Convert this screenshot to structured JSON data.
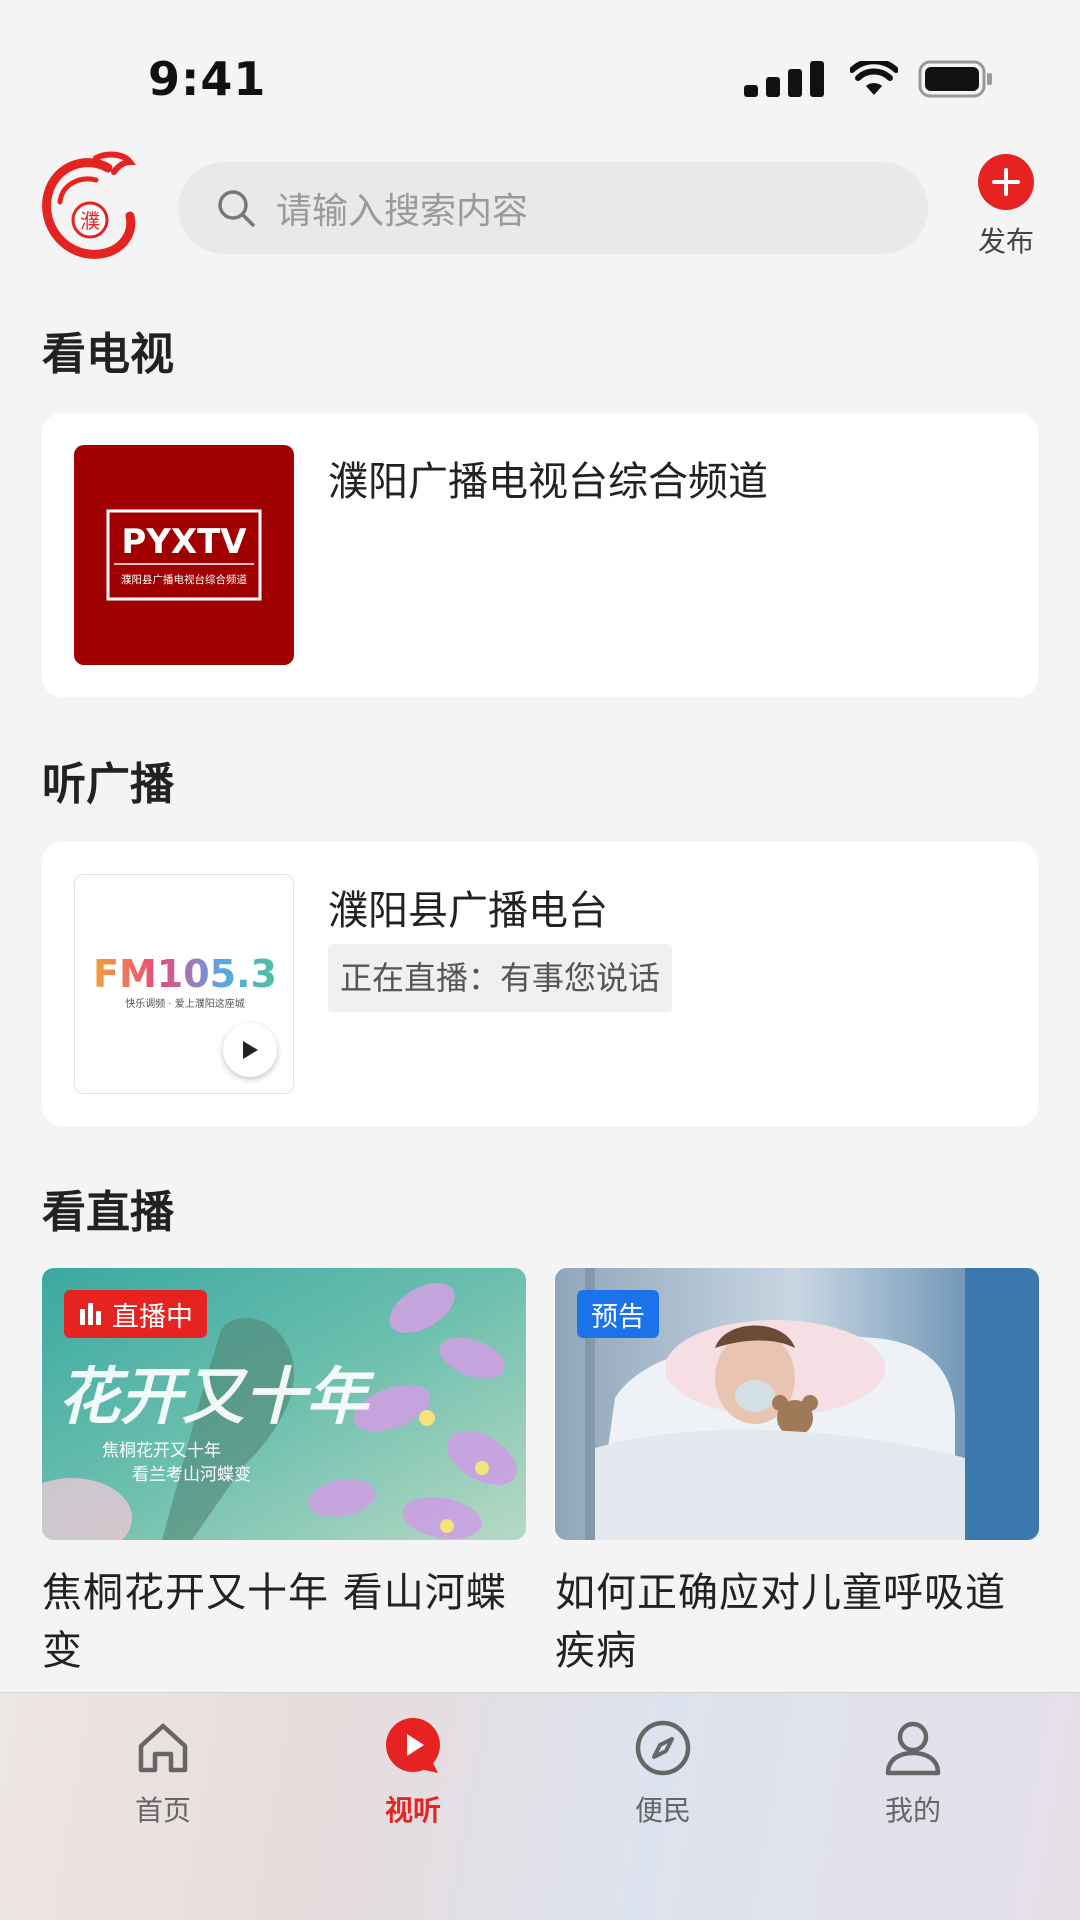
{
  "status": {
    "time": "9:41"
  },
  "header": {
    "logo_char": "濮",
    "search_placeholder": "请输入搜索内容",
    "publish_label": "发布"
  },
  "tv": {
    "section_title": "看电视",
    "channel_name": "濮阳广播电视台综合频道",
    "logo_main": "PYXTV",
    "logo_sub": "濮阳县广播电视台综合频道"
  },
  "radio": {
    "section_title": "听广播",
    "station_name": "濮阳县广播电台",
    "now_playing": "正在直播：有事您说话",
    "logo_main": "FM105.3",
    "logo_sub": "快乐调频 · 爱上濮阳这座城"
  },
  "live": {
    "section_title": "看直播",
    "items": [
      {
        "badge": "直播中",
        "title": "焦桐花开又十年 看山河蝶变",
        "art_title": "花开又十年",
        "art_line1": "焦桐花开又十年",
        "art_line2": "看兰考山河蝶变"
      },
      {
        "badge": "预告",
        "title": "如何正确应对儿童呼吸道疾病"
      }
    ]
  },
  "tabs": [
    {
      "label": "首页",
      "icon": "home-icon"
    },
    {
      "label": "视听",
      "icon": "play-icon",
      "active": true
    },
    {
      "label": "便民",
      "icon": "compass-icon"
    },
    {
      "label": "我的",
      "icon": "user-icon"
    }
  ],
  "colors": {
    "accent": "#e62321",
    "preview": "#1a73e8",
    "tv_logo_bg": "#a00000"
  }
}
